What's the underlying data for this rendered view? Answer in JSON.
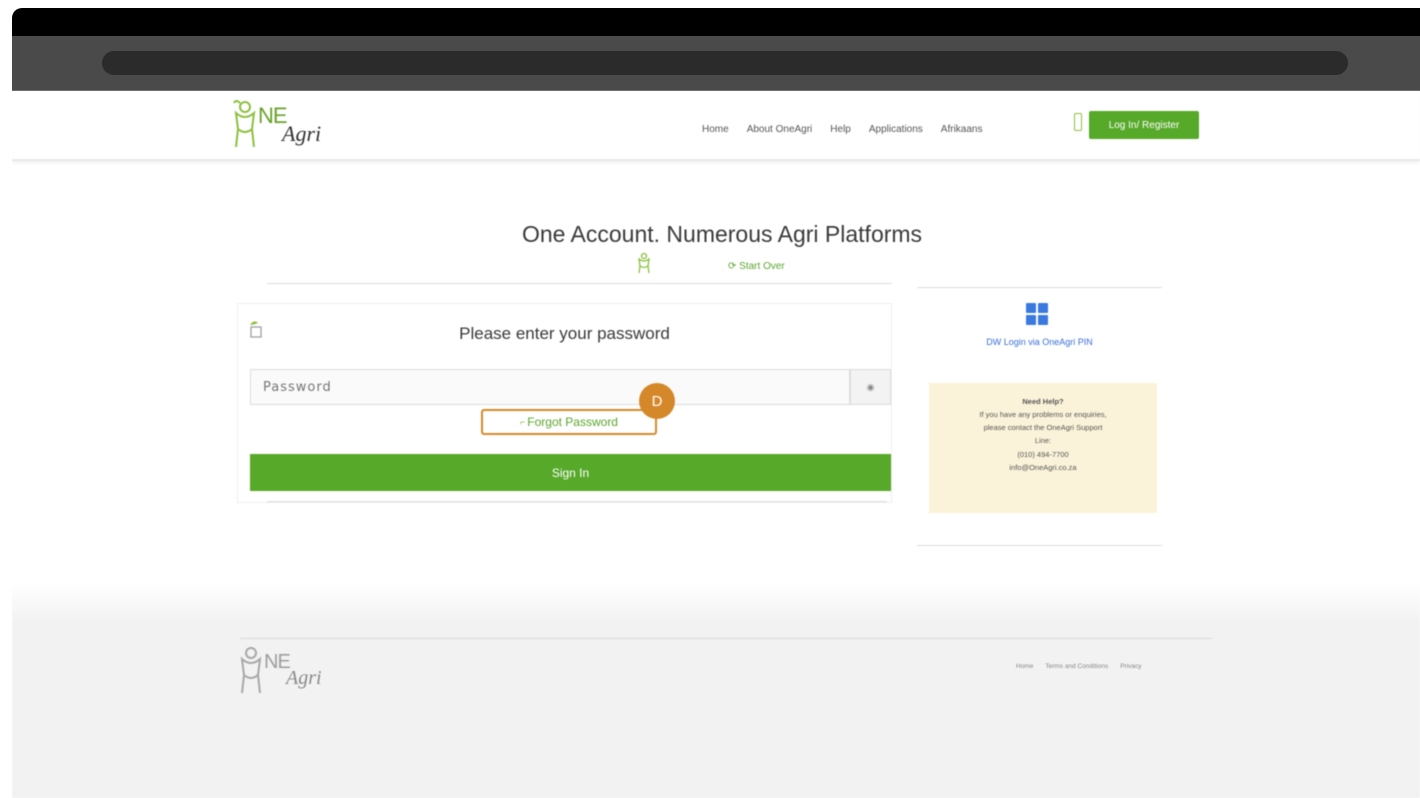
{
  "header": {
    "logo_text_main": "NE",
    "logo_text_sub": "Agri",
    "nav": [
      "Home",
      "About OneAgri",
      "Help",
      "Applications",
      "Afrikaans"
    ],
    "login_button": "Log In/ Register"
  },
  "main": {
    "headline": "One Account. Numerous Agri Platforms",
    "start_over": "Start Over",
    "card": {
      "title": "Please enter your password",
      "password_placeholder": "Password",
      "forgot_password": "Forgot Password",
      "sign_in": "Sign In"
    },
    "annotation_badge": "D",
    "side": {
      "dw_link": "DW Login via OneAgri PIN",
      "help_title": "Need Help?",
      "help_lines": [
        "If you have any problems or enquiries,",
        "please contact the OneAgri Support",
        "Line:",
        "(010) 494-7700",
        "info@OneAgri.co.za"
      ]
    }
  },
  "footer": {
    "links": [
      "Home",
      "Terms and Conditions",
      "Privacy"
    ]
  },
  "colors": {
    "brand_green": "#57a92a",
    "annotation_orange": "#d5882a",
    "link_blue": "#3a6ed8",
    "help_bg": "#fbf3d9"
  }
}
